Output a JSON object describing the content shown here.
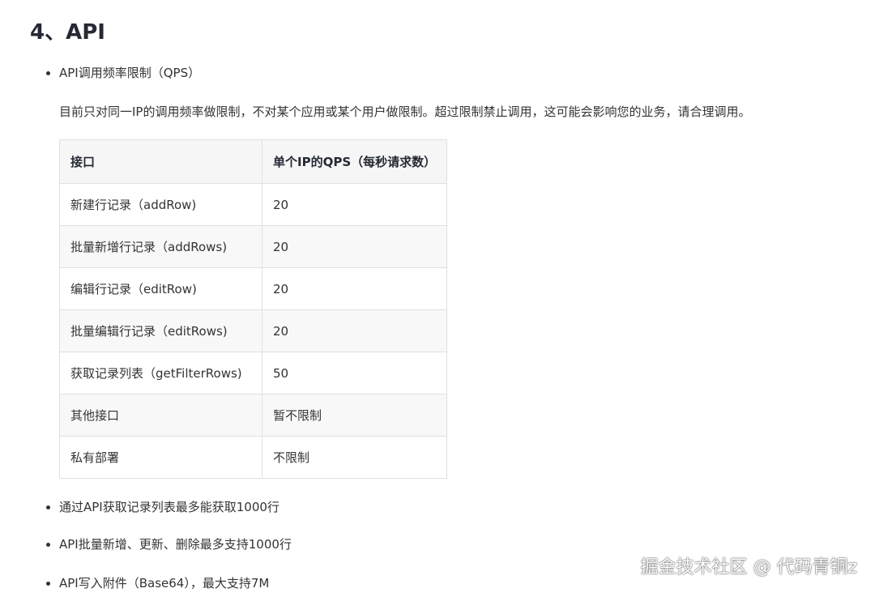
{
  "heading": "4、API",
  "bullets": {
    "qps_title": "API调用频率限制（QPS）",
    "filter_limit": "通过API获取记录列表最多能获取1000行",
    "batch_limit": "API批量新增、更新、删除最多支持1000行",
    "attachment_limit": "API写入附件（Base64），最大支持7M"
  },
  "description": "目前只对同一IP的调用频率做限制，不对某个应用或某个用户做限制。超过限制禁止调用，这可能会影响您的业务，请合理调用。",
  "table": {
    "headers": [
      "接口",
      "单个IP的QPS（每秒请求数）"
    ],
    "rows": [
      [
        "新建行记录（addRow)",
        "20"
      ],
      [
        "批量新增行记录（addRows)",
        "20"
      ],
      [
        "编辑行记录（editRow)",
        "20"
      ],
      [
        "批量编辑行记录（editRows)",
        "20"
      ],
      [
        "获取记录列表（getFilterRows)",
        "50"
      ],
      [
        "其他接口",
        "暂不限制"
      ],
      [
        "私有部署",
        "不限制"
      ]
    ]
  },
  "watermark": "掘金技术社区 @ 代码青铜z"
}
